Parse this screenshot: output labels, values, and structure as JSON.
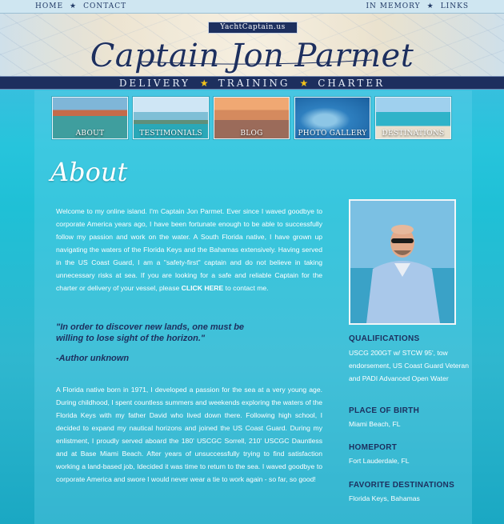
{
  "topnav": {
    "left": [
      "HOME",
      "CONTACT"
    ],
    "right": [
      "IN MEMORY",
      "LINKS"
    ]
  },
  "brand": "YachtCaptain.us",
  "site_title": "Captain Jon Parmet",
  "services": [
    "DELIVERY",
    "TRAINING",
    "CHARTER"
  ],
  "thumbs": [
    "ABOUT",
    "TESTIMONIALS",
    "BLOG",
    "PHOTO GALLERY",
    "DESTINATIONS"
  ],
  "about_title": "About",
  "intro": {
    "before_link": "Welcome to my online island. I'm Captain Jon Parmet. Ever since I waved goodbye to corporate America years ago, I have been fortunate enough to be able to successfully follow my passion and work on the water. A South Florida native, I have grown up navigating the waters of the Florida Keys and the Bahamas extensively. Having served in the US Coast Guard, I am a \"safety-first\" captain and do not believe in taking unnecessary risks at sea. If you are looking for a safe and reliable Captain for the charter or delivery of your vessel, please ",
    "link": "CLICK HERE",
    "after_link": " to contact me."
  },
  "quote": "\"In order to discover new lands, one must be willing to lose sight of the horizon.\"",
  "quote_author": "-Author unknown",
  "bio": "A Florida native born in 1971, I developed a passion for the sea at a very young age. During childhood, I spent countless summers and weekends exploring the waters of the Florida Keys with my father David who lived down there. Following high school, I decided to expand my nautical horizons and joined the US Coast Guard. During my enlistment, I proudly served aboard the 180' USCGC Sorrell, 210' USCGC Dauntless and at Base Miami Beach. After years of unsuccessfully trying to find satisfaction working a land-based job, Idecided it was time to return to the sea. I waved goodbye to corporate America and swore I would never wear a tie to work again - so far, so good!",
  "sidebar": {
    "qualifications_h": "QUALIFICATIONS",
    "qualifications": "USCG 200GT w/ STCW 95', tow endorsement, US Coast Guard Veteran and PADI Advanced Open Water",
    "pob_h": "PLACE OF BIRTH",
    "pob": "Miami Beach, FL",
    "homeport_h": "HOMEPORT",
    "homeport": "Fort Lauderdale, FL",
    "fav_h": "FAVORITE DESTINATIONS",
    "fav": "Florida Keys, Bahamas"
  }
}
